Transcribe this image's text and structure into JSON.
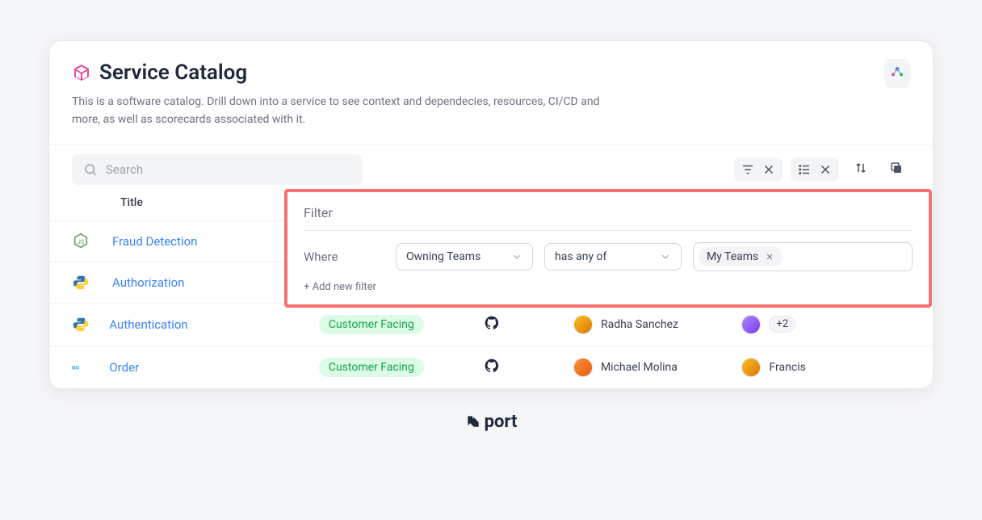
{
  "header": {
    "title": "Service Catalog",
    "subtitle": "This is a software catalog. Drill down into a service to see context and dependecies, resources, CI/CD and more, as well as scorecards associated with it."
  },
  "search": {
    "placeholder": "Search"
  },
  "table": {
    "columns": {
      "title": "Title"
    },
    "rows": [
      {
        "icon": "nodejs",
        "title": "Fraud Detection"
      },
      {
        "icon": "python",
        "title": "Authorization"
      },
      {
        "icon": "python",
        "title": "Authentication",
        "badge": "Customer Facing",
        "person1": "Radha Sanchez",
        "overflow": "+2"
      },
      {
        "icon": "go",
        "title": "Order",
        "badge": "Customer Facing",
        "person1": "Michael Molina",
        "person2": "Francis"
      }
    ]
  },
  "filter": {
    "title": "Filter",
    "where": "Where",
    "field": "Owning Teams",
    "operator": "has any of",
    "tag": "My Teams",
    "add": "+ Add new filter"
  },
  "footer": {
    "brand": "port"
  }
}
